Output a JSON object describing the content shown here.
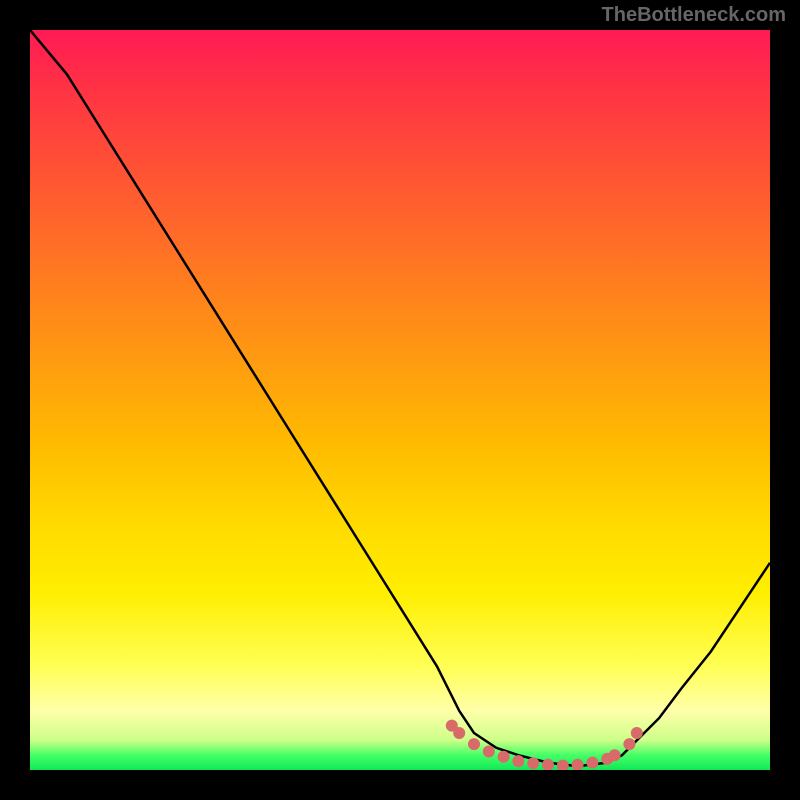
{
  "attribution": "TheBottleneck.com",
  "chart_data": {
    "type": "line",
    "title": "",
    "xlabel": "",
    "ylabel": "",
    "xlim": [
      0,
      100
    ],
    "ylim": [
      0,
      100
    ],
    "series": [
      {
        "name": "bottleneck-curve",
        "x": [
          0,
          5,
          10,
          15,
          20,
          25,
          30,
          35,
          40,
          45,
          50,
          55,
          58,
          60,
          63,
          66,
          70,
          74,
          78,
          80,
          82,
          85,
          88,
          92,
          96,
          100
        ],
        "y": [
          100,
          94,
          86,
          78,
          70,
          62,
          54,
          46,
          38,
          30,
          22,
          14,
          8,
          5,
          3,
          2,
          1,
          0.5,
          1,
          2,
          4,
          7,
          11,
          16,
          22,
          28
        ]
      }
    ],
    "markers": {
      "name": "highlight-dots",
      "color": "#d96a6a",
      "points": [
        {
          "x": 57,
          "y": 6.0
        },
        {
          "x": 58,
          "y": 5.0
        },
        {
          "x": 60,
          "y": 3.5
        },
        {
          "x": 62,
          "y": 2.5
        },
        {
          "x": 64,
          "y": 1.8
        },
        {
          "x": 66,
          "y": 1.2
        },
        {
          "x": 68,
          "y": 0.9
        },
        {
          "x": 70,
          "y": 0.7
        },
        {
          "x": 72,
          "y": 0.6
        },
        {
          "x": 74,
          "y": 0.7
        },
        {
          "x": 76,
          "y": 1.0
        },
        {
          "x": 78,
          "y": 1.5
        },
        {
          "x": 79,
          "y": 2.0
        },
        {
          "x": 81,
          "y": 3.5
        },
        {
          "x": 82,
          "y": 5.0
        }
      ]
    },
    "gradient_stops": [
      {
        "pos": 0,
        "color": "#ff1a55"
      },
      {
        "pos": 50,
        "color": "#ffbb00"
      },
      {
        "pos": 90,
        "color": "#ffff55"
      },
      {
        "pos": 100,
        "color": "#11e858"
      }
    ]
  }
}
